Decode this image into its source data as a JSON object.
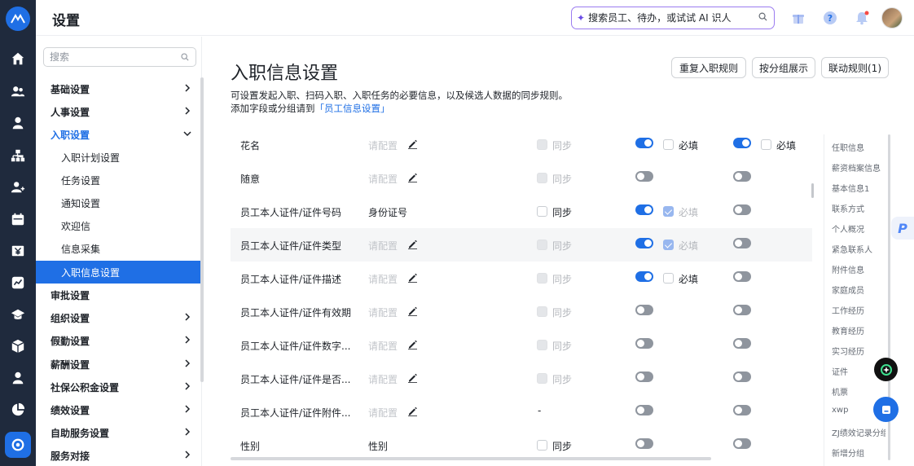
{
  "app": {
    "title": "设置"
  },
  "topbar": {
    "search_placeholder": "搜索员工、待办，或试试 AI 识人",
    "notification_badge_color": "#f54a45"
  },
  "rail": {
    "icons": [
      "home-icon",
      "people-icon",
      "person-icon",
      "org-chart-icon",
      "person-plus-icon",
      "calendar-icon",
      "money-icon",
      "chart-box-icon",
      "graduation-icon",
      "cube-icon",
      "person-solid-icon",
      "pie-chart-icon",
      "settings-icon"
    ],
    "active": "settings-icon"
  },
  "sidebar": {
    "search_placeholder": "搜索",
    "items": [
      {
        "label": "基础设置"
      },
      {
        "label": "人事设置"
      },
      {
        "label": "入职设置"
      },
      {
        "label": "入职计划设置"
      },
      {
        "label": "任务设置"
      },
      {
        "label": "通知设置"
      },
      {
        "label": "欢迎信"
      },
      {
        "label": "信息采集"
      },
      {
        "label": "入职信息设置"
      },
      {
        "label": "审批设置"
      },
      {
        "label": "组织设置"
      },
      {
        "label": "假勤设置"
      },
      {
        "label": "薪酬设置"
      },
      {
        "label": "社保公积金设置"
      },
      {
        "label": "绩效设置"
      },
      {
        "label": "自助服务设置"
      },
      {
        "label": "服务对接"
      }
    ]
  },
  "main": {
    "title": "入职信息设置",
    "buttons": {
      "reset": "重复入职规则",
      "group_view": "按分组展示",
      "linkage": "联动规则(1)"
    },
    "desc1": "可设置发起入职、扫码入职、入职任务的必要信息，以及候选人数据的同步规则。",
    "desc2_prefix": "添加字段或分组请到",
    "desc2_link": "「员工信息设置」",
    "placeholder": "请配置",
    "sync_label": "同步",
    "required_label": "必填",
    "dash": "-",
    "rows": [
      {
        "name": "花名",
        "config": "",
        "sync": "disabled",
        "t1": true,
        "req1": "unchecked",
        "t2": true,
        "req2": "unchecked"
      },
      {
        "name": "随意",
        "config": "",
        "sync": "disabled",
        "t1": false,
        "req1": "none",
        "t2": false,
        "req2": "none"
      },
      {
        "name": "员工本人证件/证件号码",
        "config": "身份证号",
        "sync": "enabled",
        "t1": true,
        "req1": "checked-disabled",
        "t2": false,
        "req2": "none"
      },
      {
        "name": "员工本人证件/证件类型",
        "config": "",
        "sync": "disabled",
        "t1": true,
        "req1": "checked-disabled",
        "t2": false,
        "req2": "none"
      },
      {
        "name": "员工本人证件/证件描述",
        "config": "",
        "sync": "disabled",
        "t1": true,
        "req1": "unchecked",
        "t2": false,
        "req2": "none"
      },
      {
        "name": "员工本人证件/证件有效期",
        "config": "",
        "sync": "disabled",
        "t1": false,
        "req1": "none",
        "t2": false,
        "req2": "none"
      },
      {
        "name": "员工本人证件/证件数字...",
        "config": "",
        "sync": "disabled",
        "t1": false,
        "req1": "none",
        "t2": false,
        "req2": "none"
      },
      {
        "name": "员工本人证件/证件是否...",
        "config": "",
        "sync": "disabled",
        "t1": false,
        "req1": "none",
        "t2": false,
        "req2": "none"
      },
      {
        "name": "员工本人证件/证件附件...",
        "config": "",
        "sync": "dash",
        "t1": false,
        "req1": "none",
        "t2": false,
        "req2": "none"
      },
      {
        "name": "性别",
        "config": "性别",
        "sync": "enabled",
        "t1": false,
        "req1": "none",
        "t2": false,
        "req2": "none"
      }
    ]
  },
  "anchors": [
    "任职信息",
    "薪资档案信息",
    "基本信息1",
    "联系方式",
    "个人概况",
    "紧急联系人",
    "附件信息",
    "家庭成员",
    "工作经历",
    "教育经历",
    "实习经历",
    "证件",
    "机票",
    "xwp",
    "ZJ绩效记录分组",
    "新增分组"
  ],
  "colors": {
    "accent": "#1f6fe5",
    "rail_bg": "#1f2a3d",
    "ai_border": "#9b7cf0"
  }
}
